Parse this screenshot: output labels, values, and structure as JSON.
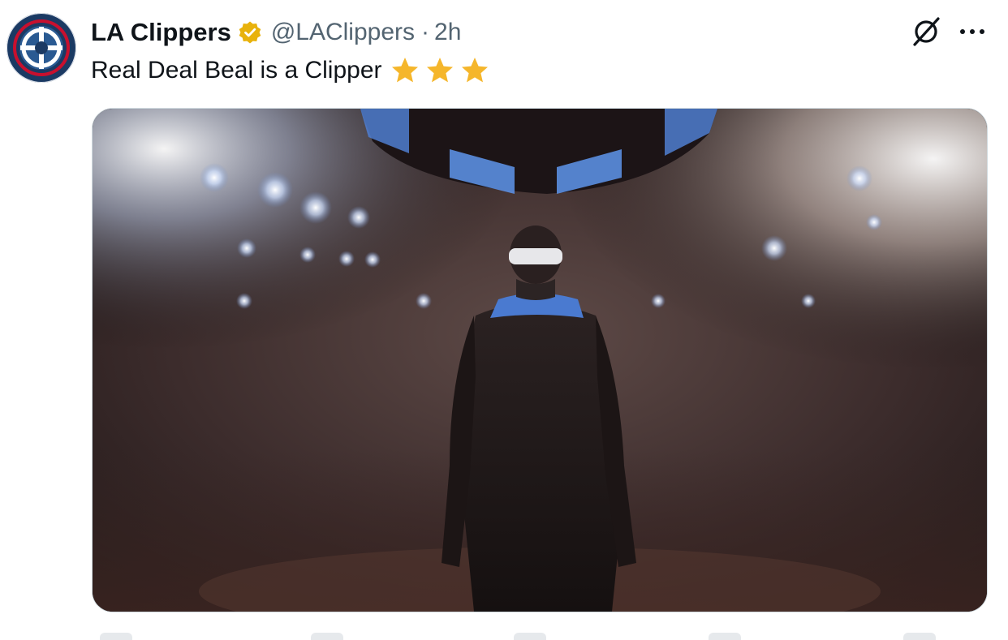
{
  "account": {
    "display_name": "LA Clippers",
    "handle": "@LAClippers",
    "separator": "·",
    "time_ago": "2h",
    "verified_color": "#e8b20c"
  },
  "post": {
    "text": "Real Deal Beal is a Clipper",
    "emoji_star_count": 3,
    "star_color": "#f5b62b"
  },
  "icons": {
    "avatar": "clippers-logo-icon",
    "verified": "verified-badge-icon",
    "grok": "grok-icon",
    "more": "more-horizontal-icon",
    "stars": "star-icon"
  },
  "media": {
    "description_type": "photo",
    "accent_blue": "#5b8ee0"
  },
  "colors": {
    "text_primary": "#0f1419",
    "text_secondary": "#536471",
    "border": "#cfd9de"
  }
}
